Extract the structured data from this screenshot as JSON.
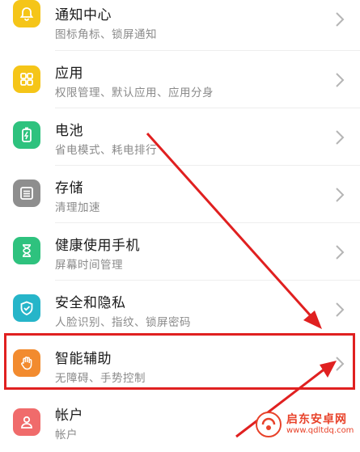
{
  "settings": {
    "items": [
      {
        "title": "通知中心",
        "subtitle": "图标角标、锁屏通知",
        "icon": "bell-icon",
        "color": "#f5c518"
      },
      {
        "title": "应用",
        "subtitle": "权限管理、默认应用、应用分身",
        "icon": "apps-grid-icon",
        "color": "#f5c518"
      },
      {
        "title": "电池",
        "subtitle": "省电模式、耗电排行",
        "icon": "battery-icon",
        "color": "#2ec27e"
      },
      {
        "title": "存储",
        "subtitle": "清理加速",
        "icon": "storage-icon",
        "color": "#8e8e8e"
      },
      {
        "title": "健康使用手机",
        "subtitle": "屏幕时间管理",
        "icon": "hourglass-icon",
        "color": "#2ec27e"
      },
      {
        "title": "安全和隐私",
        "subtitle": "人脸识别、指纹、锁屏密码",
        "icon": "shield-icon",
        "color": "#26b5c9"
      },
      {
        "title": "智能辅助",
        "subtitle": "无障碍、手势控制",
        "icon": "hand-icon",
        "color": "#f28b2f"
      },
      {
        "title": "帐户",
        "subtitle": "帐户",
        "icon": "account-icon",
        "color": "#f06b6b"
      }
    ]
  },
  "annotation": {
    "highlight_color": "#e02020"
  },
  "watermark": {
    "name": "启东安卓网",
    "url": "www.qdltdq.com"
  }
}
